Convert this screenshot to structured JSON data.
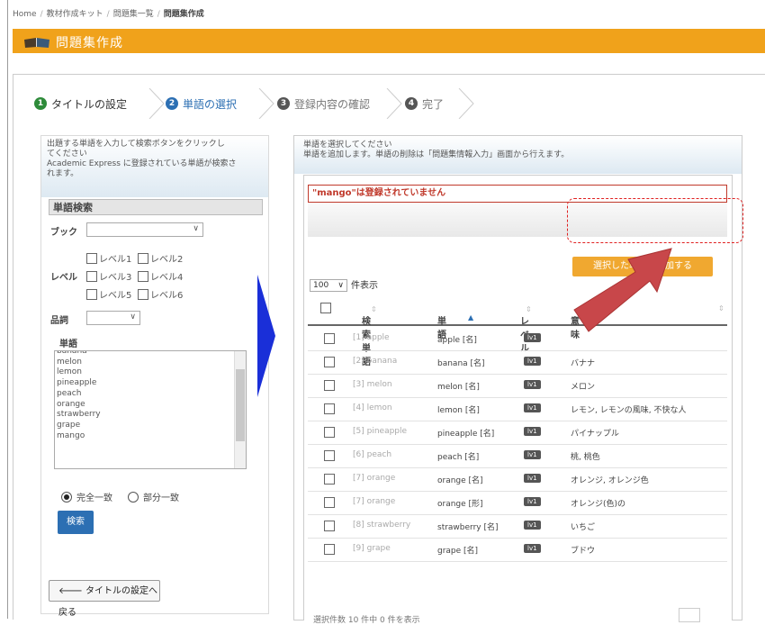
{
  "breadcrumb": {
    "home": "Home",
    "kit": "教材作成キット",
    "list": "問題集一覧",
    "current": "問題集作成",
    "sep": "/"
  },
  "header": {
    "title": "問題集作成"
  },
  "steps": [
    {
      "num": "1",
      "label": "タイトルの設定"
    },
    {
      "num": "2",
      "label": "単語の選択"
    },
    {
      "num": "3",
      "label": "登録内容の確認"
    },
    {
      "num": "4",
      "label": "完了"
    }
  ],
  "left": {
    "desc_lines": [
      "出題する単語を入力して検索ボタンをクリックし",
      "てください",
      "Academic Express に登録されている単語が検索さ",
      "れます。"
    ],
    "search_title": "単語検索",
    "book_label": "ブック",
    "level_label": "レベル",
    "levels": [
      "レベル1",
      "レベル2",
      "レベル3",
      "レベル4",
      "レベル5",
      "レベル6"
    ],
    "pos_label": "品詞",
    "word_label": "単語",
    "word_items": [
      "banana",
      "melon",
      "lemon",
      "pineapple",
      "peach",
      "orange",
      "strawberry",
      "grape",
      "mango"
    ],
    "match_exact": "完全一致",
    "match_partial": "部分一致",
    "search_button": "検索",
    "back_button": "タイトルの設定へ戻る",
    "back_icon": "arrow-left-icon"
  },
  "right": {
    "desc_lines": [
      "単語を選択してください",
      "単語を追加します。単語の削除は「問題集情報入力」画面から行えます。"
    ],
    "error": "\"mango\"は登録されていません",
    "add_button": "選択した単語を追加する",
    "page_size": "100",
    "page_size_label": "件表示",
    "columns": {
      "search_word": "検索単語",
      "word": "単語",
      "level": "レベル",
      "meaning": "意味"
    },
    "rows": [
      {
        "sw": "[1] apple",
        "w": "apple [名]",
        "lv": "lv1",
        "m": ""
      },
      {
        "sw": "[2] banana",
        "w": "banana [名]",
        "lv": "lv1",
        "m": "バナナ"
      },
      {
        "sw": "[3] melon",
        "w": "melon [名]",
        "lv": "lv1",
        "m": "メロン"
      },
      {
        "sw": "[4] lemon",
        "w": "lemon [名]",
        "lv": "lv1",
        "m": "レモン, レモンの風味, 不快な人"
      },
      {
        "sw": "[5] pineapple",
        "w": "pineapple [名]",
        "lv": "lv1",
        "m": "パイナップル"
      },
      {
        "sw": "[6] peach",
        "w": "peach [名]",
        "lv": "lv1",
        "m": "桃, 桃色"
      },
      {
        "sw": "[7] orange",
        "w": "orange [名]",
        "lv": "lv1",
        "m": "オレンジ, オレンジ色"
      },
      {
        "sw": "[7] orange",
        "w": "orange [形]",
        "lv": "lv1",
        "m": "オレンジ(色)の"
      },
      {
        "sw": "[8] strawberry",
        "w": "strawberry [名]",
        "lv": "lv1",
        "m": "いちご"
      },
      {
        "sw": "[9] grape",
        "w": "grape [名]",
        "lv": "lv1",
        "m": "ブドウ"
      }
    ],
    "footer": "選択件数 10 件中 0 件を表示"
  },
  "colors": {
    "header": "#f0a21b",
    "step_active": "#2c6fb3",
    "step_done": "#2e8b3a",
    "add_button": "#f0a830",
    "error": "#c0392b",
    "blue_arrow": "#1a2fd8",
    "red_arrow": "#c8474a"
  }
}
